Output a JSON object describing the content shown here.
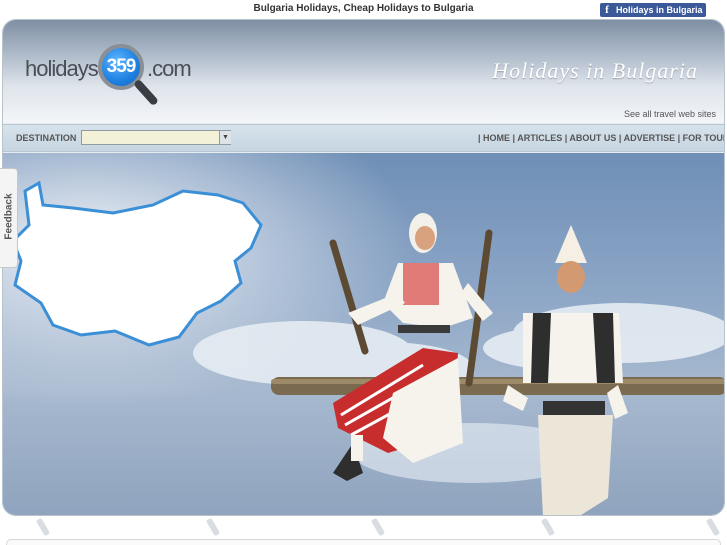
{
  "top": {
    "title": "Bulgaria Holidays, Cheap Holidays to Bulgaria",
    "facebook_badge": "Holidays in Bulgaria",
    "facebook_icon": "f"
  },
  "header": {
    "logo_left": "holidays",
    "logo_number": "359",
    "logo_right": ".com",
    "script_title": "Holidays in Bulgaria",
    "see_all": "See all travel web sites"
  },
  "nav": {
    "destination_label": "DESTINATION",
    "destination_value": "",
    "links": "| HOME | ARTICLES | ABOUT US | ADVERTISE | FOR TOURISTS |"
  },
  "feedback": {
    "label": "Feedback"
  },
  "icons": {
    "facebook": "facebook-icon",
    "dropdown": "dropdown-arrow-icon",
    "magnifier": "magnifier-logo-icon",
    "map": "bulgaria-map-icon"
  },
  "colors": {
    "facebook_blue": "#3b5998",
    "logo_blue": "#1d7fe0",
    "sky": "#8aa4c5"
  }
}
